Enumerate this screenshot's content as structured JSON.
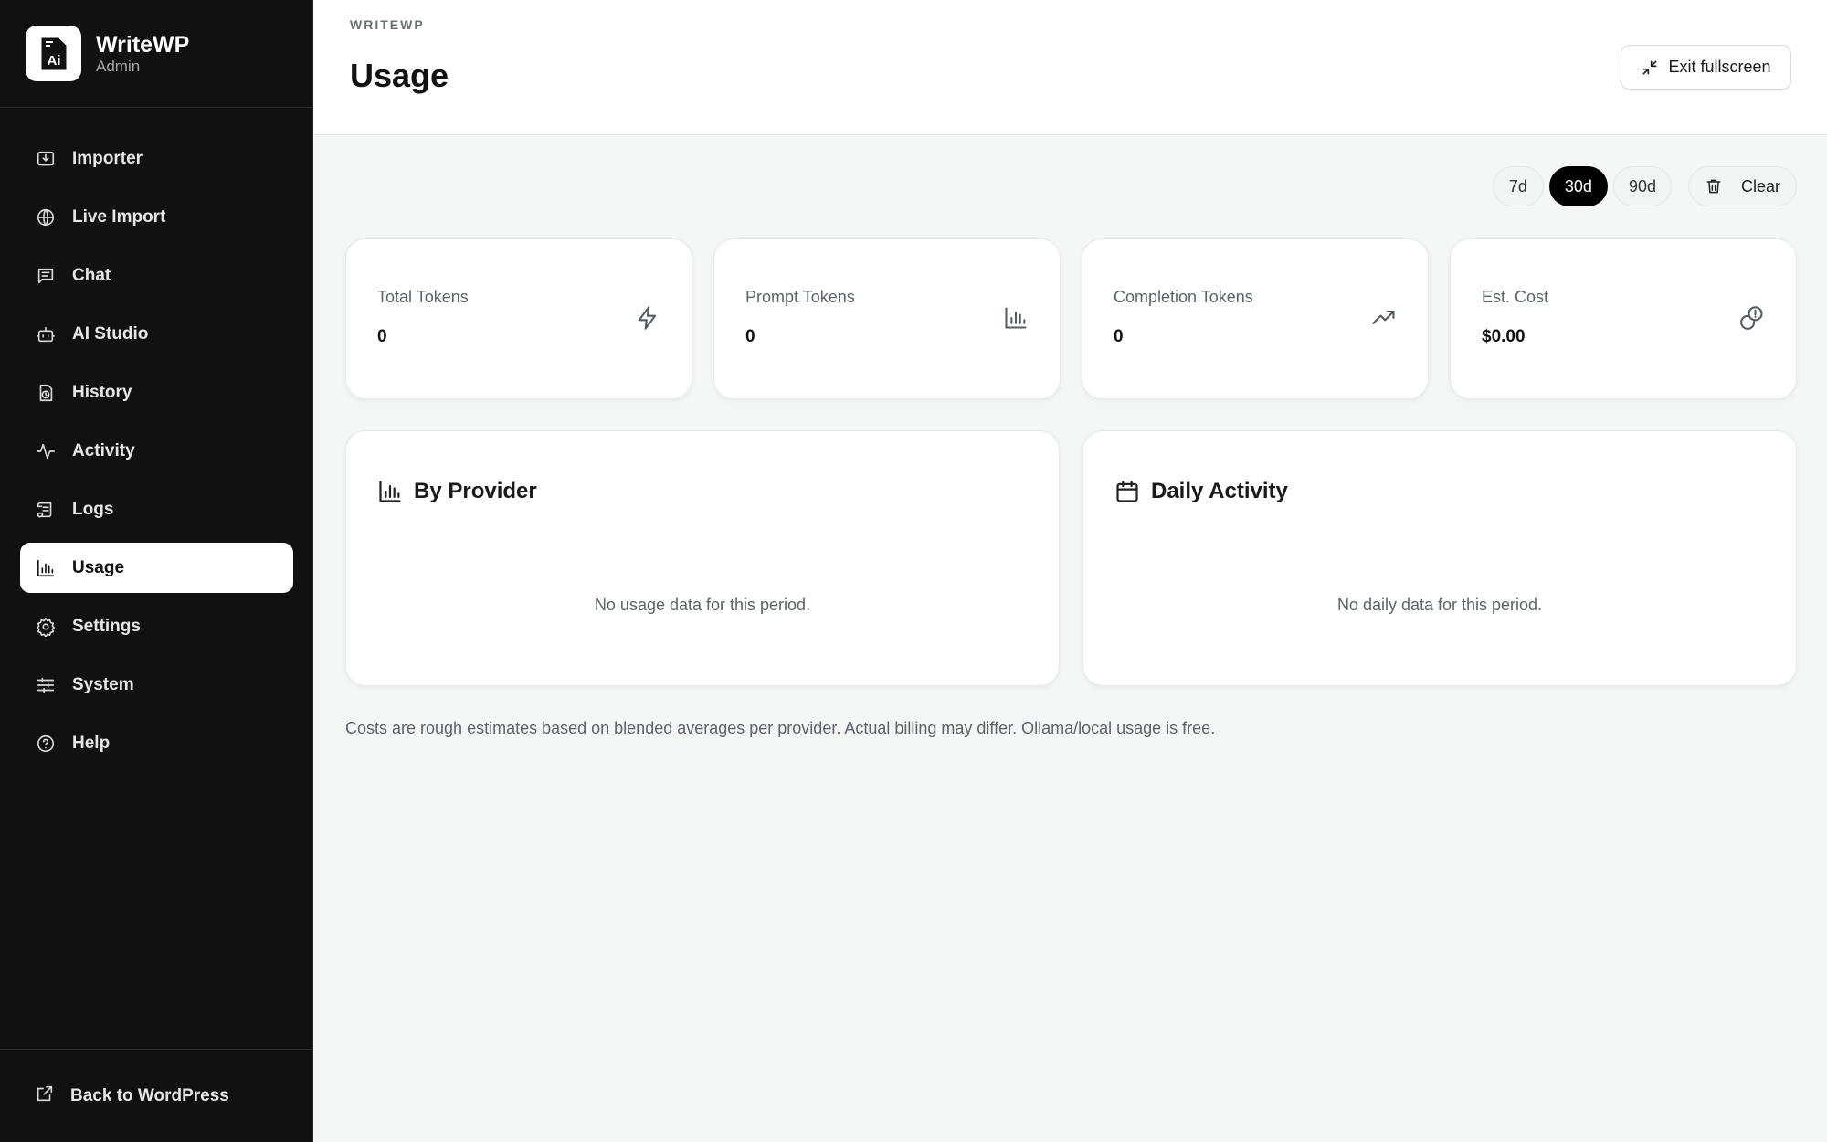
{
  "brand": {
    "name": "WriteWP",
    "subtitle": "Admin",
    "logo_text": "Ai"
  },
  "sidebar": {
    "items": [
      {
        "label": "Importer",
        "icon": "import-icon",
        "active": false
      },
      {
        "label": "Live Import",
        "icon": "globe-icon",
        "active": false
      },
      {
        "label": "Chat",
        "icon": "chat-icon",
        "active": false
      },
      {
        "label": "AI Studio",
        "icon": "bot-icon",
        "active": false
      },
      {
        "label": "History",
        "icon": "history-icon",
        "active": false
      },
      {
        "label": "Activity",
        "icon": "activity-icon",
        "active": false
      },
      {
        "label": "Logs",
        "icon": "scroll-icon",
        "active": false
      },
      {
        "label": "Usage",
        "icon": "bar-chart-icon",
        "active": true
      },
      {
        "label": "Settings",
        "icon": "gear-icon",
        "active": false
      },
      {
        "label": "System",
        "icon": "sliders-icon",
        "active": false
      },
      {
        "label": "Help",
        "icon": "help-icon",
        "active": false
      }
    ],
    "footer_label": "Back to WordPress"
  },
  "header": {
    "eyebrow": "WRITEWP",
    "title": "Usage",
    "exit_label": "Exit fullscreen"
  },
  "range": {
    "options": [
      {
        "label": "7d",
        "active": false
      },
      {
        "label": "30d",
        "active": true
      },
      {
        "label": "90d",
        "active": false
      }
    ],
    "clear_label": "Clear"
  },
  "stats": [
    {
      "label": "Total Tokens",
      "value": "0",
      "icon": "zap-icon"
    },
    {
      "label": "Prompt Tokens",
      "value": "0",
      "icon": "bar-chart-icon"
    },
    {
      "label": "Completion Tokens",
      "value": "0",
      "icon": "trending-up-icon"
    },
    {
      "label": "Est. Cost",
      "value": "$0.00",
      "icon": "coins-icon"
    }
  ],
  "panels": {
    "provider": {
      "title": "By Provider",
      "empty": "No usage data for this period."
    },
    "daily": {
      "title": "Daily Activity",
      "empty": "No daily data for this period."
    }
  },
  "footnote": "Costs are rough estimates based on blended averages per provider. Actual billing may differ. Ollama/local usage is free.",
  "colors": {
    "sidebar_bg": "#111111",
    "accent": "#000000",
    "page_bg": "#f5f6f6"
  }
}
